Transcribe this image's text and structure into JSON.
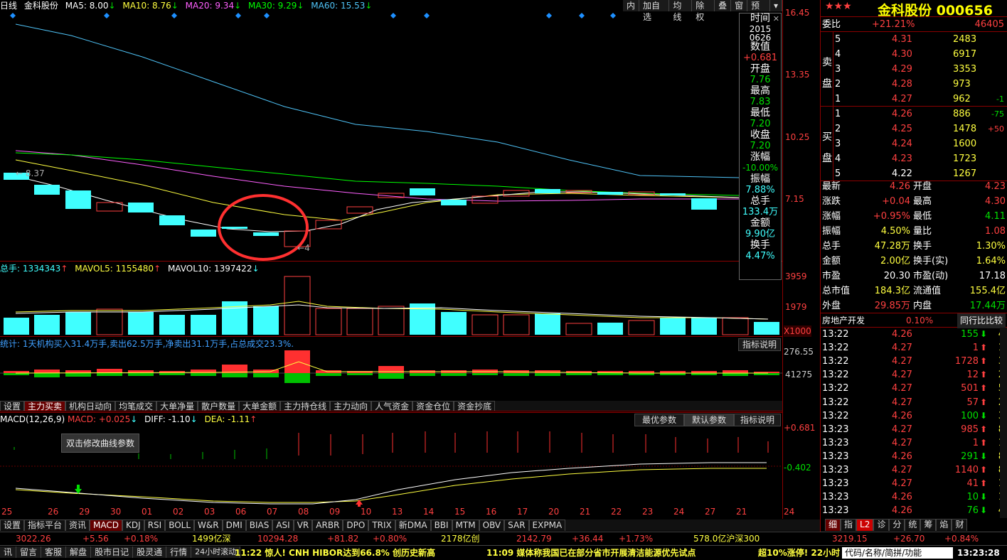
{
  "top": {
    "period": "日线",
    "name": "金科股份",
    "ma5": "MA5: 8.00",
    "ma10": "MA10: 8.76",
    "ma20": "MA20: 9.34",
    "ma30": "MA30: 9.29",
    "ma60": "MA60: 15.53",
    "btns": [
      "内",
      "加自选",
      "均线",
      "除权",
      "叠",
      "窗",
      "预测"
    ]
  },
  "axis": {
    "p1": "16.45",
    "p2": "13.35",
    "p3": "10.25",
    "p4": "7.15",
    "v1": "3959",
    "v2": "1979",
    "v3": "X1000",
    "s1": "276.55",
    "s2": "41275",
    "m1": "+0.681",
    "m2": "-0.402"
  },
  "labels": {
    "hi": "8.37",
    "lo": "4"
  },
  "vol": {
    "total": "总手: 1334343",
    "mavol5": "MAVOL5: 1155480",
    "mavol10": "MAVOL10: 1397422"
  },
  "stat": {
    "text": "统计: 1天机构买入31.4万手,卖出62.5万手,净卖出31.1万手,占总成交23.3%.",
    "btn": "指标说明"
  },
  "midtabs": [
    "设置",
    "主力买卖",
    "机构日动向",
    "均笔成交",
    "大单净量",
    "散户数量",
    "大单金额",
    "主力持仓线",
    "主力动向",
    "人气资金",
    "资金仓位",
    "资金抄底"
  ],
  "macd": {
    "title": "MACD(12,26,9)",
    "macd": "MACD: +0.025",
    "diff": "DIFF: -1.10",
    "dea": "DEA: -1.11",
    "b1": "最优参数",
    "b2": "默认参数",
    "b3": "指标说明",
    "tip": "双击修改曲线参数"
  },
  "dates": [
    "25",
    "26",
    "29",
    "30",
    "01",
    "02",
    "03",
    "06",
    "07",
    "08",
    "09",
    "10",
    "13",
    "14",
    "15",
    "16",
    "17",
    "20",
    "21",
    "22",
    "23",
    "24",
    "27",
    "21",
    "24"
  ],
  "bottabs": [
    "设置",
    "指标平台",
    "资讯",
    "MACD",
    "KDJ",
    "RSI",
    "BOLL",
    "W&R",
    "DMI",
    "BIAS",
    "ASI",
    "VR",
    "ARBR",
    "DPO",
    "TRIX",
    "新DMA",
    "BBI",
    "MTM",
    "OBV",
    "SAR",
    "EXPMA"
  ],
  "tooltip": [
    [
      "时间",
      "2015",
      "0626"
    ],
    [
      "数值",
      "+0.681"
    ],
    [
      "开盘",
      "7.76"
    ],
    [
      "最高",
      "7.83"
    ],
    [
      "最低",
      "7.20"
    ],
    [
      "收盘",
      "7.20"
    ],
    [
      "涨幅",
      "-10.00%"
    ],
    [
      "振幅",
      "7.88%"
    ],
    [
      "总手",
      "133.4万"
    ],
    [
      "金额",
      "9.90亿"
    ],
    [
      "换手",
      "4.47%"
    ]
  ],
  "stock": {
    "title": "金科股份 000656",
    "wb_label": "委比",
    "wb": "+21.21%",
    "wc": "46405"
  },
  "sell": [
    [
      "5",
      "4.31",
      "2483",
      ""
    ],
    [
      "4",
      "4.30",
      "6917",
      ""
    ],
    [
      "3",
      "4.29",
      "3353",
      ""
    ],
    [
      "2",
      "4.28",
      "973",
      ""
    ],
    [
      "1",
      "4.27",
      "962",
      "-1"
    ]
  ],
  "buy": [
    [
      "1",
      "4.26",
      "886",
      "-75"
    ],
    [
      "2",
      "4.25",
      "1478",
      "+50"
    ],
    [
      "3",
      "4.24",
      "1600",
      ""
    ],
    [
      "4",
      "4.23",
      "1723",
      ""
    ],
    [
      "5",
      "4.22",
      "1267",
      ""
    ]
  ],
  "sell_label": [
    "卖",
    "盘"
  ],
  "buy_label": [
    "买",
    "盘"
  ],
  "quote": [
    [
      "最新",
      "4.26",
      "开盘",
      "4.23"
    ],
    [
      "涨跌",
      "+0.04",
      "最高",
      "4.30"
    ],
    [
      "涨幅",
      "+0.95%",
      "最低",
      "4.11"
    ],
    [
      "振幅",
      "4.50%",
      "量比",
      "1.08"
    ],
    [
      "总手",
      "47.28万",
      "换手",
      "1.30%"
    ],
    [
      "金额",
      "2.00亿",
      "换手(实)",
      "1.64%"
    ],
    [
      "市盈",
      "20.30",
      "市盈(动)",
      "17.18"
    ],
    [
      "总市值",
      "184.3亿",
      "流通值",
      "155.4亿"
    ],
    [
      "外盘",
      "29.85万",
      "内盘",
      "17.44万"
    ]
  ],
  "sector": {
    "name": "房地产开发",
    "pct": "0.10%",
    "btn": "同行比比较"
  },
  "ticks": [
    [
      "13:22",
      "4.26",
      "155",
      "4"
    ],
    [
      "13:22",
      "4.27",
      "1",
      "1"
    ],
    [
      "13:22",
      "4.27",
      "1728",
      "3"
    ],
    [
      "13:22",
      "4.27",
      "12",
      "2"
    ],
    [
      "13:22",
      "4.27",
      "501",
      "5"
    ],
    [
      "13:22",
      "4.27",
      "57",
      "2"
    ],
    [
      "13:22",
      "4.26",
      "100",
      "3"
    ],
    [
      "13:23",
      "4.27",
      "985",
      "8"
    ],
    [
      "13:23",
      "4.27",
      "1",
      "1"
    ],
    [
      "13:23",
      "4.26",
      "291",
      "8"
    ],
    [
      "13:23",
      "4.27",
      "1140",
      "8"
    ],
    [
      "13:23",
      "4.27",
      "41",
      "1"
    ],
    [
      "13:23",
      "4.26",
      "10",
      "1"
    ],
    [
      "13:23",
      "4.26",
      "76",
      "4"
    ]
  ],
  "rtabs": [
    "细",
    "指",
    "L2",
    "诊",
    "分",
    "统",
    "筹",
    "焰",
    "财"
  ],
  "status": {
    "a": "3022.26",
    "b": "+5.56",
    "c": "+0.18%",
    "d": "1499亿深",
    "e": "10294.28",
    "f": "+81.82",
    "g": "+0.80%",
    "h": "2178亿创",
    "i": "2142.79",
    "j": "+36.44",
    "k": "+1.73%",
    "l": "578.0亿沪深300",
    "m": "3219.15",
    "n": "+26.70",
    "o": "+0.84%"
  },
  "news": {
    "tabs": [
      "讯",
      "留言",
      "客服",
      "解盘",
      "股市日记",
      "股灵通",
      "行情",
      "24小时滚动"
    ],
    "n1": "11:22 惊人! CNH HIBOR达到66.8% 创历史新高",
    "n2": "11:09 媒体称我国已在部分省市开展清洁能源优先试点",
    "n3": "超10%涨停! 22小时",
    "search": "代码/名称/简拼/功能",
    "time": "13:23:28"
  }
}
